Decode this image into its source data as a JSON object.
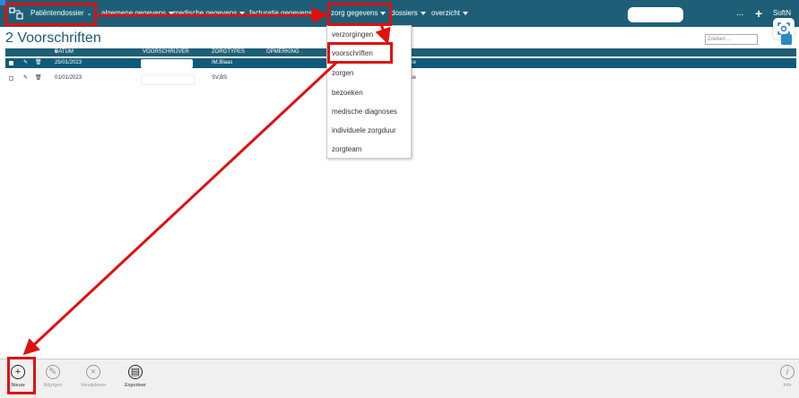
{
  "topbar": {
    "patient_dossier": "Patiëntendossier",
    "menu_sociale": "algemene gegevens",
    "menu_medische": "medische gegevens",
    "menu_facturatie": "facturatie gegevens",
    "menu_zorg": "zorg gegevens",
    "menu_dossiers": "dossiers",
    "menu_overzicht": "overzicht",
    "more": "...",
    "plus": "+",
    "user": "SoftN"
  },
  "page_title": "2 Voorschriften",
  "search_placeholder": "Zoeken ...",
  "table": {
    "headers": [
      "DATUM VOORSCHRIFT",
      "VOORSCHRIJVER",
      "ZORGTYPES",
      "OPMERKING"
    ],
    "rows": [
      {
        "date": "25/01/2023",
        "types": "IM,Blaas",
        "note": "ijke"
      },
      {
        "date": "01/01/2023",
        "types": "SV,BS",
        "note": "ijke"
      }
    ]
  },
  "dropdown": {
    "items": [
      "verzorgingen",
      "voorschriften",
      "zorgen",
      "bezoeken",
      "medische diagnoses",
      "individuele zorgduur",
      "zorgteam"
    ]
  },
  "footer": {
    "new": "Nieuw",
    "edit": "Wijzigen",
    "delete": "Verwijderen",
    "export": "Exporteer",
    "info": "Info"
  },
  "colors": {
    "accent": "#1e5f77",
    "annotation": "#e01010"
  }
}
